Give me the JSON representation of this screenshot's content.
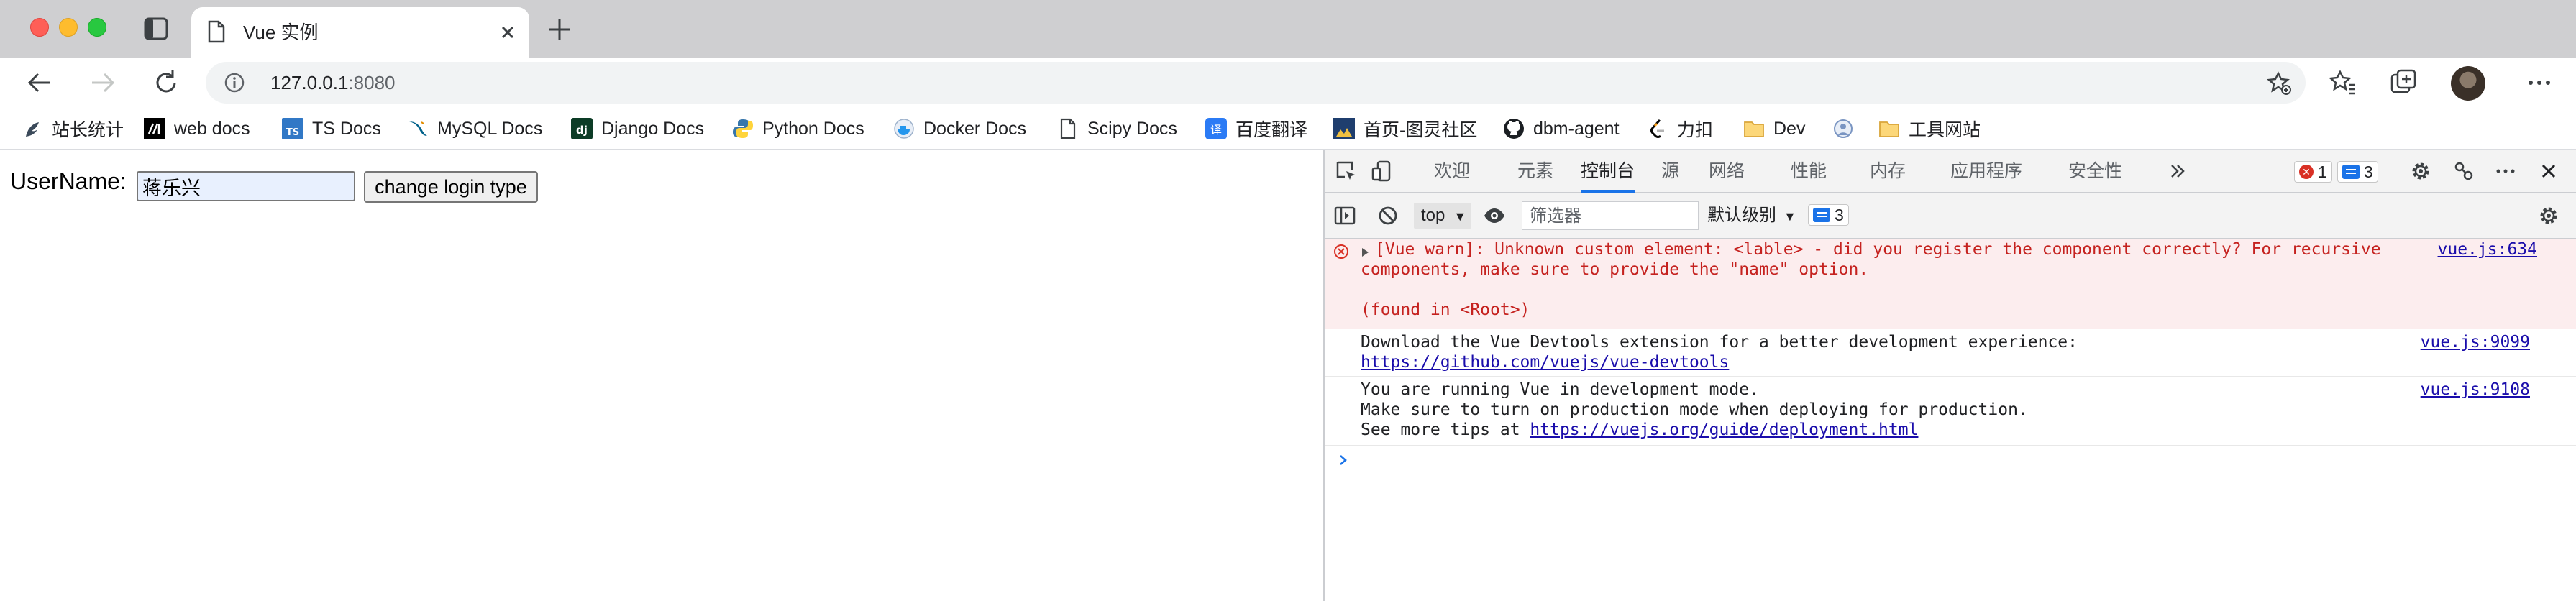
{
  "browser": {
    "tab": {
      "title": "Vue 实例"
    },
    "address": {
      "host": "127.0.0.1",
      "port": ":8080"
    },
    "bookmarks": [
      {
        "label": "站长统计",
        "icon": "bird-icon"
      },
      {
        "label": "web docs",
        "icon": "mdn-icon"
      },
      {
        "label": "TS Docs",
        "icon": "typescript-icon"
      },
      {
        "label": "MySQL Docs",
        "icon": "mysql-icon"
      },
      {
        "label": "Django Docs",
        "icon": "django-icon"
      },
      {
        "label": "Python Docs",
        "icon": "python-icon"
      },
      {
        "label": "Docker Docs",
        "icon": "docker-icon"
      },
      {
        "label": "Scipy Docs",
        "icon": "document-icon"
      },
      {
        "label": "百度翻译",
        "icon": "translate-icon"
      },
      {
        "label": "首页-图灵社区",
        "icon": "turing-icon"
      },
      {
        "label": "dbm-agent",
        "icon": "github-icon"
      },
      {
        "label": "力扣",
        "icon": "leetcode-icon"
      },
      {
        "label": "Dev",
        "icon": "folder-icon"
      },
      {
        "label": "",
        "icon": "globe-icon"
      },
      {
        "label": "工具网站",
        "icon": "folder-icon"
      }
    ]
  },
  "page": {
    "username_label": "UserName:",
    "username_value": "蒋乐兴",
    "change_button": "change login type"
  },
  "devtools": {
    "tabs": [
      {
        "label": "欢迎",
        "active": false
      },
      {
        "label": "元素",
        "active": false
      },
      {
        "label": "控制台",
        "active": true
      },
      {
        "label": "源",
        "active": false
      },
      {
        "label": "网络",
        "active": false
      },
      {
        "label": "性能",
        "active": false
      },
      {
        "label": "内存",
        "active": false
      },
      {
        "label": "应用程序",
        "active": false
      },
      {
        "label": "安全性",
        "active": false
      }
    ],
    "error_count": "1",
    "message_count": "3",
    "context": "top",
    "filter_placeholder": "筛选器",
    "level": "默认级别",
    "filter_message_count": "3",
    "messages": {
      "error": {
        "line1": "[Vue warn]: Unknown custom element: <lable> - did you register the component correctly? For recursive",
        "line2": "components, make sure to provide the \"name\" option.",
        "line3": "(found in <Root>)",
        "source": "vue.js:634"
      },
      "devtools_tip": {
        "line1": "Download the Vue Devtools extension for a better development experience:",
        "link": "https://github.com/vuejs/vue-devtools",
        "source": "vue.js:9099"
      },
      "dev_mode": {
        "line1": "You are running Vue in development mode.",
        "line2": "Make sure to turn on production mode when deploying for production.",
        "line3_prefix": "See more tips at ",
        "link": "https://vuejs.org/guide/deployment.html",
        "source": "vue.js:9108"
      }
    }
  },
  "colors": {
    "tab_strip": "#cfcfd1",
    "accent": "#1a73e8",
    "error_bg": "#fcedee",
    "error_text": "#c5221f",
    "link": "#1a0dab"
  }
}
